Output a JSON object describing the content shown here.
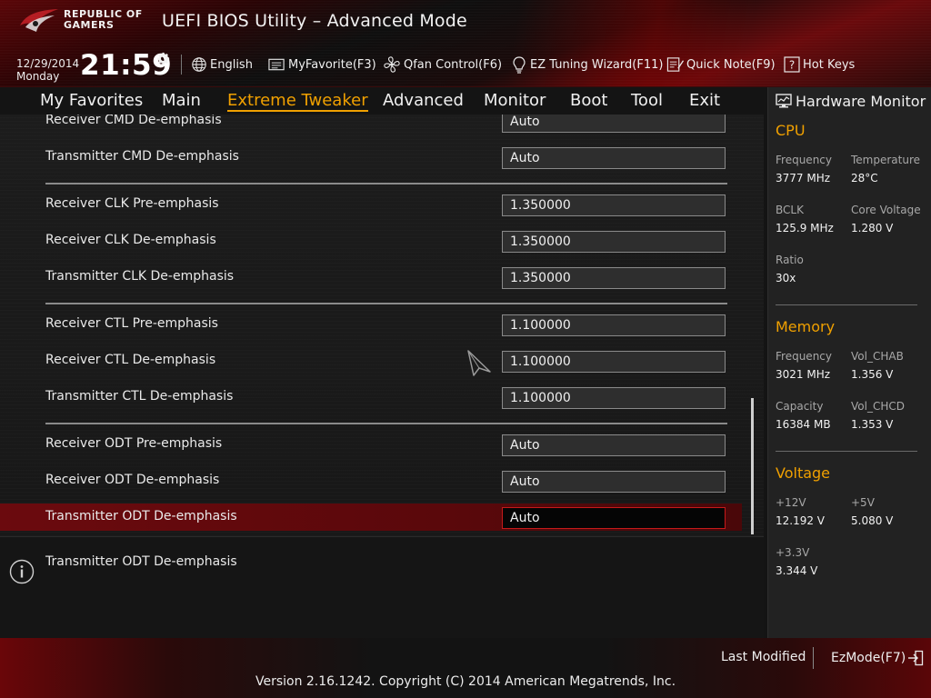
{
  "header": {
    "brand_line1": "REPUBLIC OF",
    "brand_line2": "GAMERS",
    "title": "UEFI BIOS Utility – Advanced Mode",
    "date": "12/29/2014",
    "weekday": "Monday",
    "time": "21:59",
    "toolbar": {
      "language": "English",
      "my_favorite": "MyFavorite(F3)",
      "qfan": "Qfan Control(F6)",
      "ez_tuning": "EZ Tuning Wizard(F11)",
      "quick_note": "Quick Note(F9)",
      "hot_keys": "Hot Keys"
    },
    "icons": [
      "rog-logo",
      "gear-icon",
      "globe-icon",
      "favorite-icon",
      "fan-icon",
      "bulb-icon",
      "note-icon",
      "help-icon"
    ]
  },
  "tabs": [
    {
      "label": "My Favorites",
      "active": false
    },
    {
      "label": "Main",
      "active": false
    },
    {
      "label": "Extreme Tweaker",
      "active": true
    },
    {
      "label": "Advanced",
      "active": false
    },
    {
      "label": "Monitor",
      "active": false
    },
    {
      "label": "Boot",
      "active": false
    },
    {
      "label": "Tool",
      "active": false
    },
    {
      "label": "Exit",
      "active": false
    }
  ],
  "settings": [
    {
      "label": "Receiver CMD De-emphasis",
      "value": "Auto"
    },
    {
      "label": "Transmitter CMD De-emphasis",
      "value": "Auto"
    },
    {
      "label": "Receiver CLK Pre-emphasis",
      "value": "1.350000"
    },
    {
      "label": "Receiver CLK De-emphasis",
      "value": "1.350000"
    },
    {
      "label": "Transmitter CLK De-emphasis",
      "value": "1.350000"
    },
    {
      "label": "Receiver CTL Pre-emphasis",
      "value": "1.100000"
    },
    {
      "label": "Receiver CTL De-emphasis",
      "value": "1.100000"
    },
    {
      "label": "Transmitter CTL De-emphasis",
      "value": "1.100000"
    },
    {
      "label": "Receiver ODT Pre-emphasis",
      "value": "Auto"
    },
    {
      "label": "Receiver ODT De-emphasis",
      "value": "Auto"
    },
    {
      "label": "Transmitter ODT De-emphasis",
      "value": "Auto",
      "selected": true
    }
  ],
  "help": {
    "text": "Transmitter ODT De-emphasis",
    "icon": "info-icon"
  },
  "hardware_monitor": {
    "title": "Hardware Monitor",
    "cpu": {
      "title": "CPU",
      "frequency_label": "Frequency",
      "frequency": "3777 MHz",
      "temperature_label": "Temperature",
      "temperature": "28°C",
      "bclk_label": "BCLK",
      "bclk": "125.9 MHz",
      "core_voltage_label": "Core Voltage",
      "core_voltage": "1.280 V",
      "ratio_label": "Ratio",
      "ratio": "30x"
    },
    "memory": {
      "title": "Memory",
      "frequency_label": "Frequency",
      "frequency": "3021 MHz",
      "vol_chab_label": "Vol_CHAB",
      "vol_chab": "1.356 V",
      "capacity_label": "Capacity",
      "capacity": "16384 MB",
      "vol_chcd_label": "Vol_CHCD",
      "vol_chcd": "1.353 V"
    },
    "voltage": {
      "title": "Voltage",
      "v12_label": "+12V",
      "v12": "12.192 V",
      "v5_label": "+5V",
      "v5": "5.080 V",
      "v33_label": "+3.3V",
      "v33": "3.344 V"
    }
  },
  "footer": {
    "last_modified": "Last Modified",
    "ez_mode": "EzMode(F7)",
    "copyright": "Version 2.16.1242. Copyright (C) 2014 American Megatrends, Inc."
  },
  "colors": {
    "accent": "#f0a000",
    "selection": "#6b0a0e",
    "selected_border": "#c51a1a",
    "brand_red": "#8b0a0e"
  }
}
